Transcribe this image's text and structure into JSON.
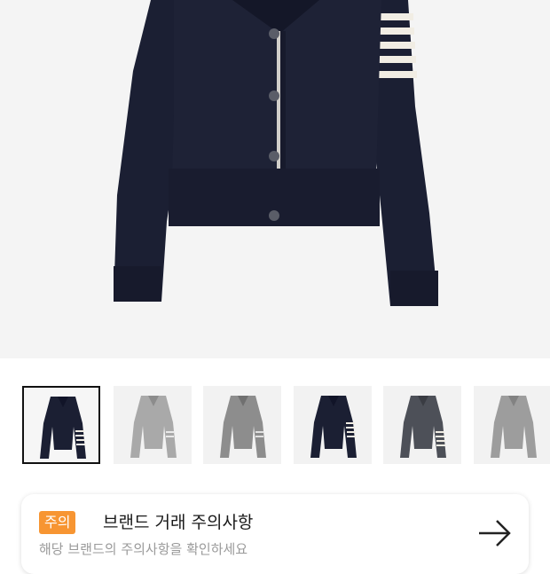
{
  "colors": {
    "hero_background": "#f4f4f4",
    "navy": "#1b1f33",
    "gray_light": "#a9a9a9",
    "gray_mid": "#8d8d8d",
    "charcoal": "#4d5058",
    "badge": "#f79532"
  },
  "gallery": {
    "main_image": "navy-cardigan-four-bar-stripes",
    "thumbnails": [
      {
        "name": "navy-cardigan-stripes",
        "selected": true
      },
      {
        "name": "light-gray-cardigan",
        "selected": false
      },
      {
        "name": "mid-gray-cardigan",
        "selected": false
      },
      {
        "name": "navy-cardigan-stripes-alt",
        "selected": false
      },
      {
        "name": "charcoal-cardigan-stripes",
        "selected": false
      },
      {
        "name": "gray-cardigan-partial",
        "selected": false
      }
    ]
  },
  "notice": {
    "badge": "주의",
    "title": "브랜드 거래 주의사항",
    "subtitle": "해당 브랜드의 주의사항을 확인하세요",
    "arrow_icon": "arrow-right-icon"
  }
}
